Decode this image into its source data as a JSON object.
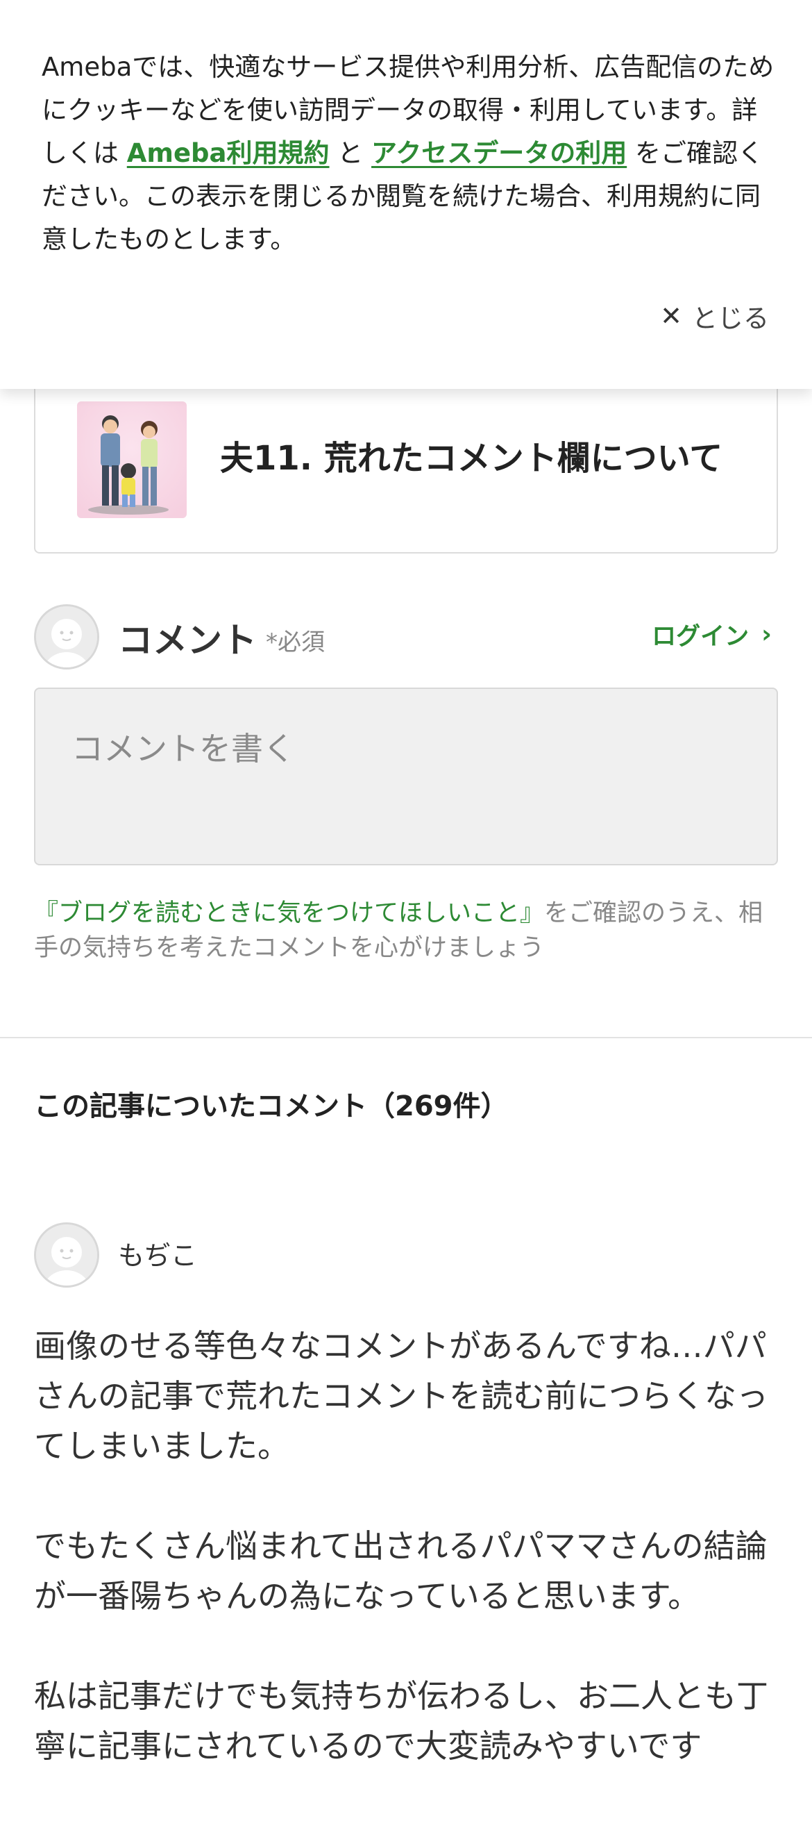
{
  "cookie_banner": {
    "text_part1": "Amebaでは、快適なサービス提供や利用分析、広告配信のためにクッキーなどを使い訪問データの取得・利用しています。詳しくは ",
    "link1": "Ameba利用規約",
    "text_part2": " と ",
    "link2": "アクセスデータの利用",
    "text_part3": " をご確認ください。この表示を閉じるか閲覧を続けた場合、利用規約に同意したものとします。",
    "close_label": "とじる",
    "close_icon": "close-icon"
  },
  "article_card": {
    "title": "夫11. 荒れたコメント欄について"
  },
  "comment_form": {
    "label": "コメント",
    "required": "*必須",
    "login_label": "ログイン",
    "placeholder": "コメントを書く",
    "notice_link": "『ブログを読むときに気をつけてほしいこと』",
    "notice_text": "をご確認のうえ、相手の気持ちを考えたコメントを心がけましょう"
  },
  "comments": {
    "heading": "この記事についたコメント（269件）",
    "items": [
      {
        "name": "もぢこ",
        "paragraphs": [
          "画像のせる等色々なコメントがあるんですね…パパさんの記事で荒れたコメントを読む前につらくなってしまいました。",
          "でもたくさん悩まれて出されるパパママさんの結論が一番陽ちゃんの為になっていると思います。",
          "私は記事だけでも気持ちが伝わるし、お二人とも丁寧に記事にされているので大変読みやすいです"
        ]
      }
    ]
  },
  "colors": {
    "accent_green": "#2d8a34",
    "text_dark": "#333333",
    "text_muted": "#888888"
  }
}
